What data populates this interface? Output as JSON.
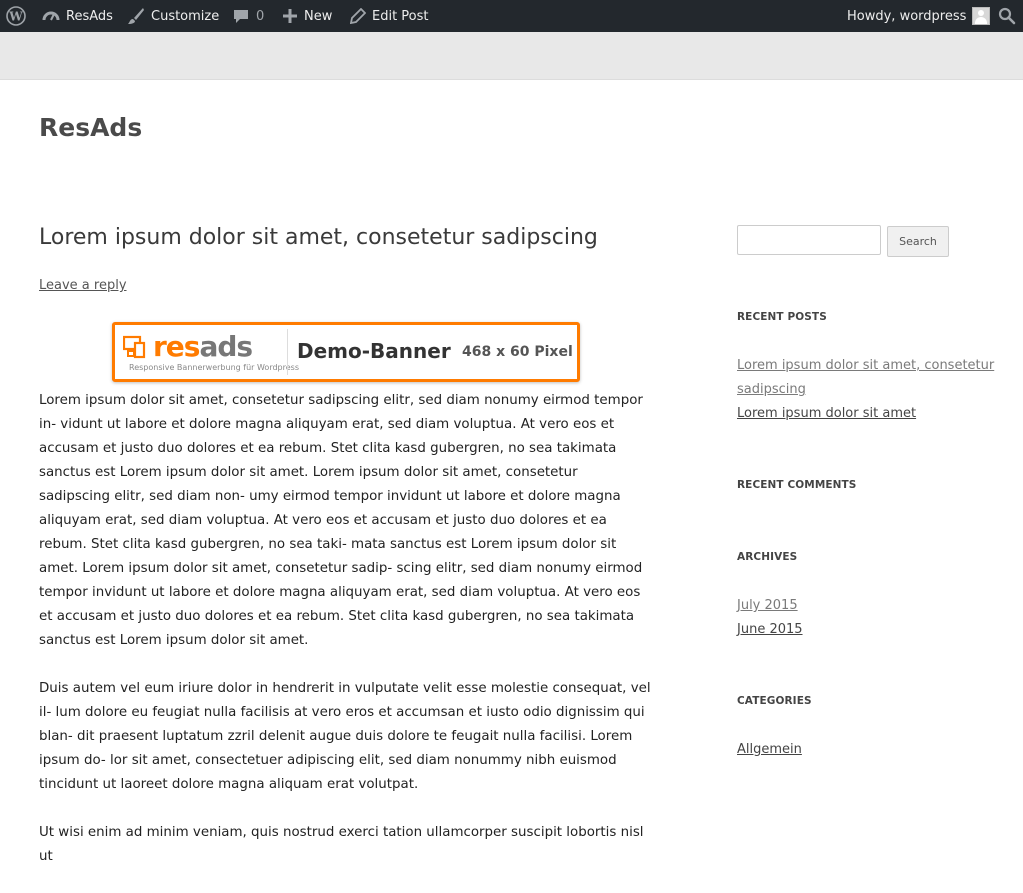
{
  "adminbar": {
    "site_name": "ResAds",
    "customize": "Customize",
    "comments_count": "0",
    "new_label": "New",
    "edit_post": "Edit Post",
    "howdy": "Howdy, wordpress"
  },
  "site": {
    "title": "ResAds"
  },
  "post": {
    "title": "Lorem ipsum dolor sit amet, consetetur sadipscing",
    "reply_link": "Leave a reply",
    "banner": {
      "logo_res": "res",
      "logo_ads": "ads",
      "tagline": "Responsive Bannerwerbung für Wordpress",
      "title": "Demo-Banner",
      "size": "468 x 60 Pixel"
    },
    "paragraphs": [
      "Lorem ipsum dolor sit amet, consetetur sadipscing elitr, sed diam nonumy eirmod tempor in- vidunt ut labore et dolore magna aliquyam erat, sed diam voluptua. At vero eos et accusam et justo duo dolores et ea rebum. Stet clita kasd gubergren, no sea takimata sanctus est Lorem ipsum dolor sit amet. Lorem ipsum dolor sit amet, consetetur sadipscing elitr, sed diam non- umy eirmod tempor invidunt ut labore et dolore magna aliquyam erat, sed diam voluptua. At vero eos et accusam et justo duo dolores et ea rebum. Stet clita kasd gubergren, no sea taki- mata sanctus est Lorem ipsum dolor sit amet. Lorem ipsum dolor sit amet, consetetur sadip- scing elitr, sed diam nonumy eirmod tempor invidunt ut labore et dolore magna aliquyam erat, sed diam voluptua. At vero eos et accusam et justo duo dolores et ea rebum. Stet clita kasd gubergren, no sea takimata sanctus est Lorem ipsum dolor sit amet.",
      "Duis autem vel eum iriure dolor in hendrerit in vulputate velit esse molestie consequat, vel il- lum dolore eu feugiat nulla facilisis at vero eros et accumsan et iusto odio dignissim qui blan- dit praesent luptatum zzril delenit augue duis dolore te feugait nulla facilisi. Lorem ipsum do- lor sit amet, consectetuer adipiscing elit, sed diam nonummy nibh euismod tincidunt ut laoreet dolore magna aliquam erat volutpat.",
      "Ut wisi enim ad minim veniam, quis nostrud exerci tation ullamcorper suscipit lobortis nisl ut"
    ]
  },
  "sidebar": {
    "search": {
      "value": "",
      "button": "Search"
    },
    "recent_posts": {
      "title": "RECENT POSTS",
      "items": [
        "Lorem ipsum dolor sit amet, consetetur",
        "sadipscing",
        "Lorem ipsum dolor sit amet"
      ]
    },
    "recent_comments": {
      "title": "RECENT COMMENTS"
    },
    "archives": {
      "title": "ARCHIVES",
      "items": [
        "July 2015",
        "June 2015"
      ]
    },
    "categories": {
      "title": "CATEGORIES",
      "items": [
        "Allgemein"
      ]
    }
  },
  "colors": {
    "adminbar": "#23282d",
    "banner_accent": "#ff7b00",
    "header_band": "#e8e8e8"
  }
}
